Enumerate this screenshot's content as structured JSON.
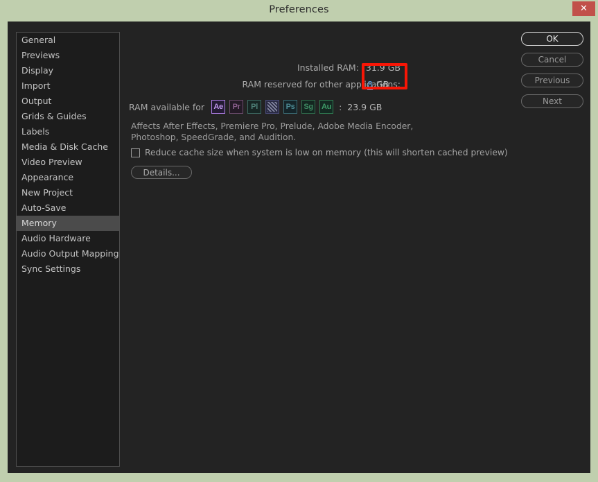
{
  "window": {
    "title": "Preferences",
    "close_label": "✕",
    "titlebar_color": "#c0cfae",
    "close_button_color": "#c1504a",
    "body_color": "#232323"
  },
  "sidebar": {
    "items": [
      {
        "label": "General",
        "selected": false
      },
      {
        "label": "Previews",
        "selected": false
      },
      {
        "label": "Display",
        "selected": false
      },
      {
        "label": "Import",
        "selected": false
      },
      {
        "label": "Output",
        "selected": false
      },
      {
        "label": "Grids & Guides",
        "selected": false
      },
      {
        "label": "Labels",
        "selected": false
      },
      {
        "label": "Media & Disk Cache",
        "selected": false
      },
      {
        "label": "Video Preview",
        "selected": false
      },
      {
        "label": "Appearance",
        "selected": false
      },
      {
        "label": "New Project",
        "selected": false
      },
      {
        "label": "Auto-Save",
        "selected": false
      },
      {
        "label": "Memory",
        "selected": true
      },
      {
        "label": "Audio Hardware",
        "selected": false
      },
      {
        "label": "Audio Output Mapping",
        "selected": false
      },
      {
        "label": "Sync Settings",
        "selected": false
      }
    ]
  },
  "buttons": [
    {
      "label": "OK",
      "primary": true
    },
    {
      "label": "Cancel",
      "primary": false
    },
    {
      "label": "Previous",
      "primary": false
    },
    {
      "label": "Next",
      "primary": false
    }
  ],
  "memory": {
    "installed_ram_label": "Installed RAM:",
    "installed_ram_value": "31.9 GB",
    "reserved_ram_label": "RAM reserved for other applications:",
    "reserved_ram_value": "8",
    "reserved_ram_unit": "GB",
    "reserved_ram_value_color": "#5a9bd8",
    "ram_available_label": "RAM available for",
    "ram_available_colon": ":",
    "ram_available_value": "23.9 GB",
    "app_icons": [
      {
        "name": "after-effects-icon",
        "glyph": "Ae",
        "class": "ae",
        "active": true
      },
      {
        "name": "premiere-pro-icon",
        "glyph": "Pr",
        "class": "pr",
        "active": false
      },
      {
        "name": "prelude-icon",
        "glyph": "Pl",
        "class": "pl",
        "active": false
      },
      {
        "name": "media-encoder-icon",
        "glyph": "",
        "class": "me",
        "active": false
      },
      {
        "name": "photoshop-icon",
        "glyph": "Ps",
        "class": "ps",
        "active": false
      },
      {
        "name": "speedgrade-icon",
        "glyph": "Sg",
        "class": "sg",
        "active": false
      },
      {
        "name": "audition-icon",
        "glyph": "Au",
        "class": "au",
        "active": false
      }
    ],
    "affects_text": "Affects After Effects, Premiere Pro, Prelude, Adobe Media Encoder, Photoshop, SpeedGrade, and Audition.",
    "reduce_cache_label": "Reduce cache size when system is low on memory (this will shorten cached preview)",
    "reduce_cache_checked": false,
    "details_button_label": "Details..."
  },
  "annotation": {
    "type": "rectangle-highlight",
    "color": "#f81606",
    "targets": "reserved-ram-value"
  }
}
